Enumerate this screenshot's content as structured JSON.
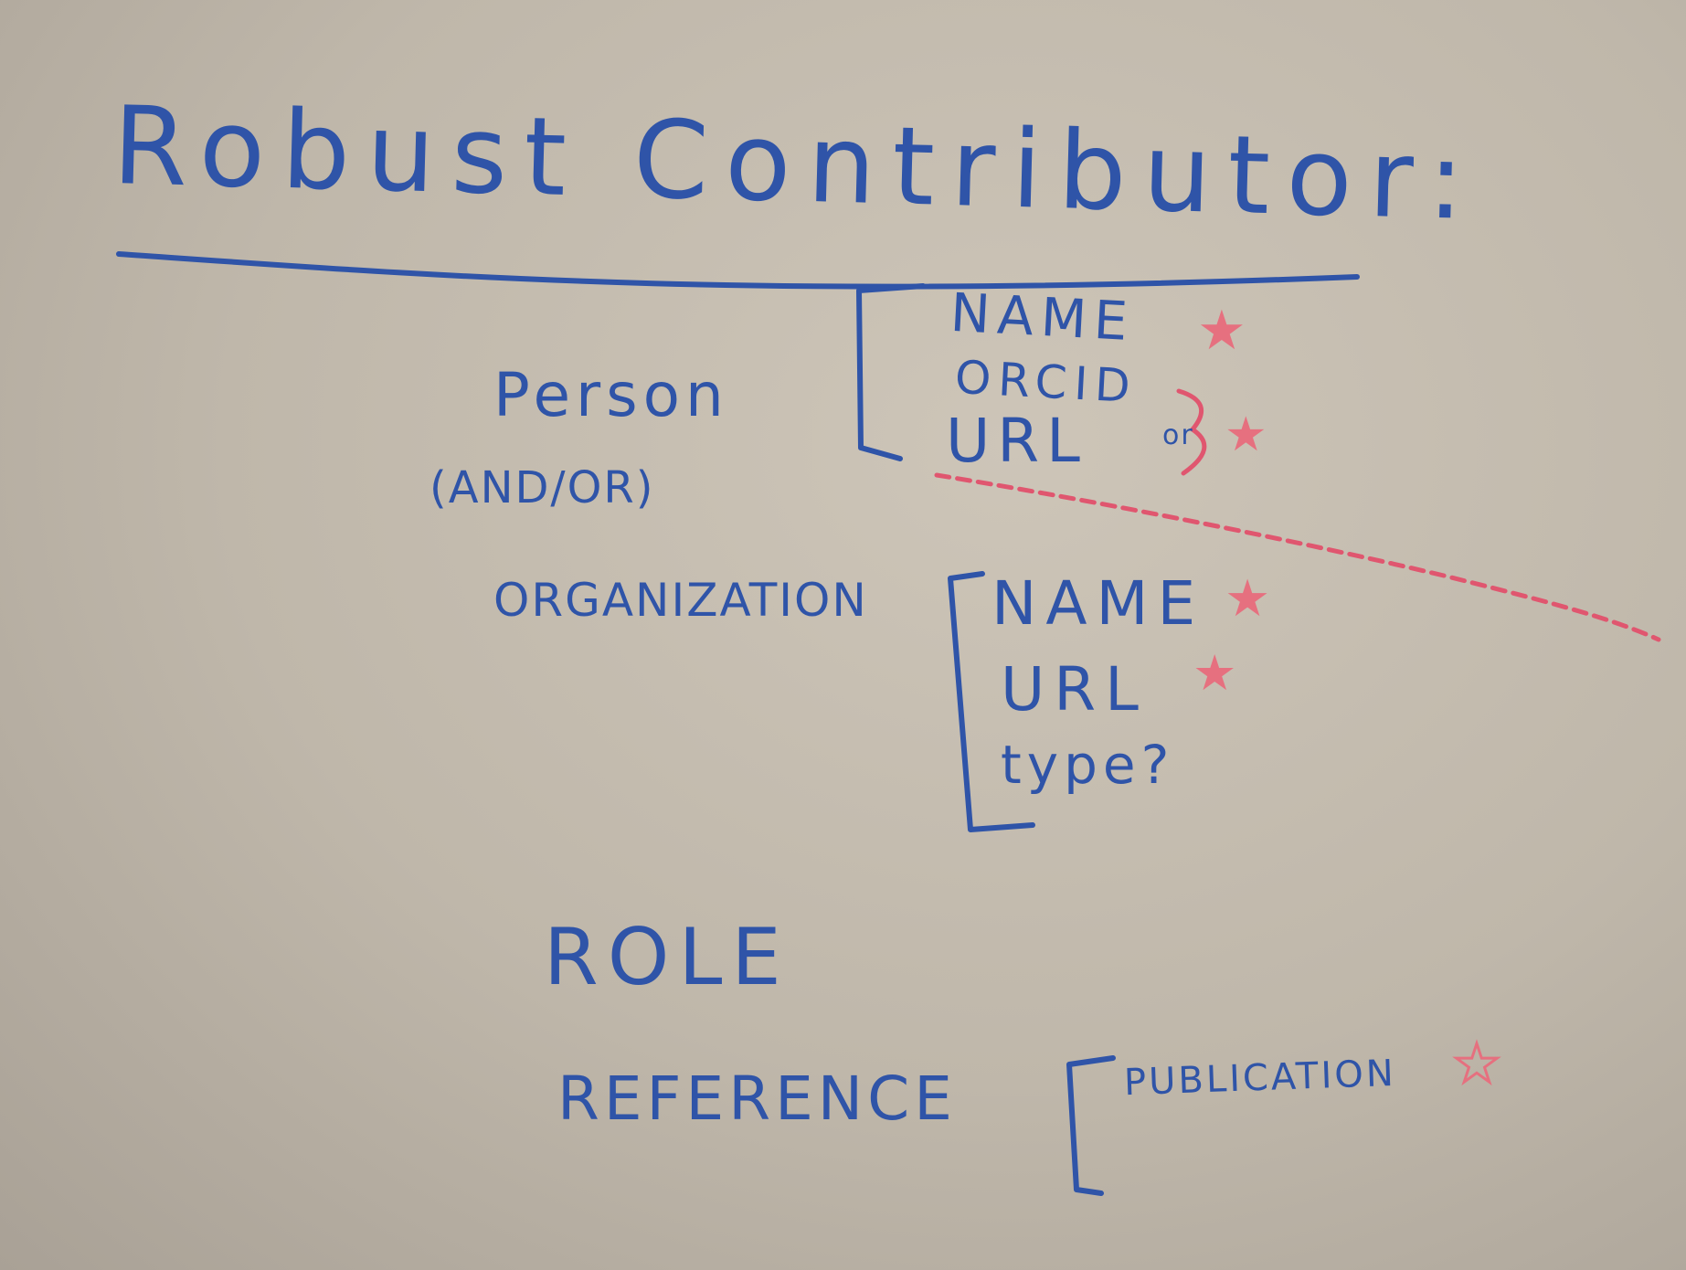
{
  "whiteboard": {
    "title": "Robust Contributor:",
    "person": {
      "label": "Person",
      "fields": [
        "NAME",
        "ORCID",
        "URL"
      ],
      "url_suffix": "or"
    },
    "and_or": "(AND/OR)",
    "organization": {
      "label": "ORGANIZATION",
      "fields": [
        "NAME",
        "URL",
        "type?"
      ]
    },
    "role": "ROLE",
    "reference": {
      "label": "REFERENCE",
      "fields": [
        "PUBLICATION"
      ]
    },
    "colors": {
      "board": "#c4bcb0",
      "blue_marker": "#2f54a8",
      "red_marker": "#e0566f",
      "star": "#e6707f"
    },
    "icons": [
      "star-icon"
    ]
  }
}
